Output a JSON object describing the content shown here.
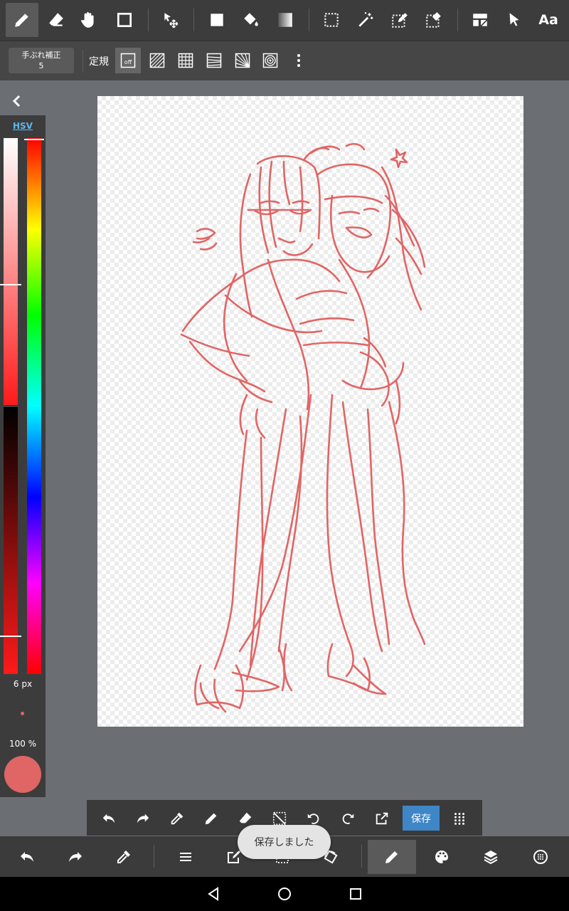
{
  "top_toolbar": {
    "tools": [
      "pen-icon",
      "eraser-icon",
      "hand-icon",
      "shape-rect-icon",
      "move-icon",
      "fill-rect-icon",
      "bucket-icon",
      "gradient-icon",
      "select-rect-icon",
      "magic-wand-icon",
      "select-pen-icon",
      "select-eraser-icon",
      "frame-divider-icon",
      "pointer-icon",
      "text-icon"
    ],
    "text_tool_label": "Aa"
  },
  "sub_toolbar": {
    "stabilizer_label": "手ぶれ補正",
    "stabilizer_value": "5",
    "ruler_label": "定規",
    "ruler_off_label": "off",
    "ruler_tools": [
      "parallel-ruler-icon",
      "grid-ruler-icon",
      "perspective-ruler-icon",
      "radial-ruler-icon",
      "concentric-ruler-icon"
    ]
  },
  "color_panel": {
    "mode_label": "HSV",
    "brush_size": "6 px",
    "opacity": "100 %",
    "current_color": "#e06565"
  },
  "quick_bar": {
    "save_label": "保存"
  },
  "bottom_toolbar": {
    "items": [
      "undo-icon",
      "redo-icon",
      "eyedropper-icon",
      "menu-icon",
      "edit-icon",
      "selection-icon",
      "rotate-icon",
      "brush-icon",
      "palette-icon",
      "layers-icon",
      "material-icon"
    ]
  },
  "toast": {
    "message": "保存しました"
  },
  "colors": {
    "accent": "#3f86c7",
    "sketch": "#e06565"
  }
}
